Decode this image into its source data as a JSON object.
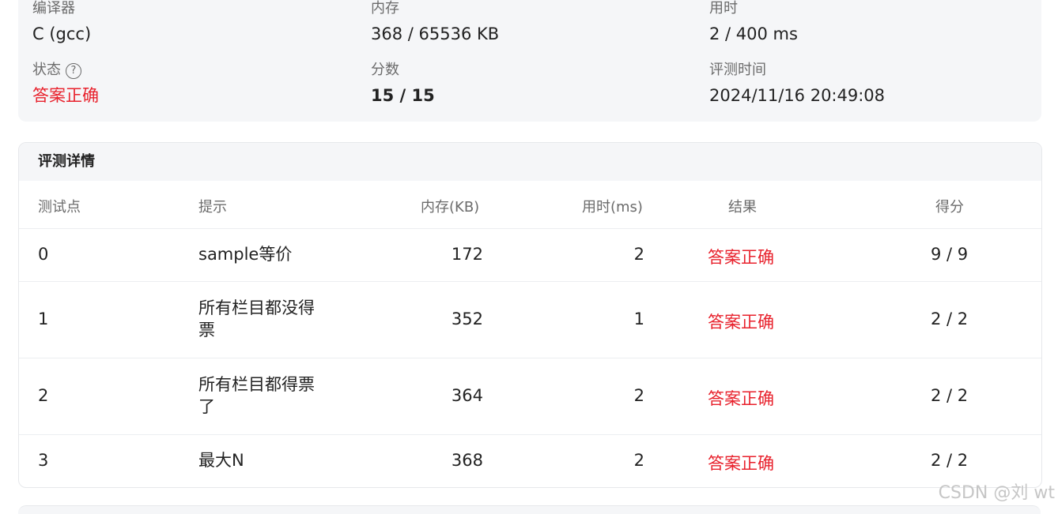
{
  "summary": {
    "compiler": {
      "label": "编译器",
      "value": "C (gcc)"
    },
    "memory": {
      "label": "内存",
      "value": "368 / 65536 KB"
    },
    "time": {
      "label": "用时",
      "value": "2 / 400 ms"
    },
    "status": {
      "label": "状态",
      "help_icon": "?",
      "value": "答案正确",
      "color": "#e8212c"
    },
    "score": {
      "label": "分数",
      "value": "15 / 15"
    },
    "judge_time": {
      "label": "评测时间",
      "value": "2024/11/16 20:49:08"
    }
  },
  "details": {
    "title": "评测详情",
    "columns": {
      "case": "测试点",
      "hint": "提示",
      "memory": "内存(KB)",
      "time": "用时(ms)",
      "result": "结果",
      "score": "得分"
    },
    "rows": [
      {
        "case": "0",
        "hint": "sample等价",
        "memory": "172",
        "time": "2",
        "result": "答案正确",
        "score": "9 / 9"
      },
      {
        "case": "1",
        "hint": "所有栏目都没得票",
        "memory": "352",
        "time": "1",
        "result": "答案正确",
        "score": "2 / 2"
      },
      {
        "case": "2",
        "hint": "所有栏目都得票了",
        "memory": "364",
        "time": "2",
        "result": "答案正确",
        "score": "2 / 2"
      },
      {
        "case": "3",
        "hint": "最大N",
        "memory": "368",
        "time": "2",
        "result": "答案正确",
        "score": "2 / 2"
      }
    ]
  },
  "watermark": "CSDN @刘 wt"
}
